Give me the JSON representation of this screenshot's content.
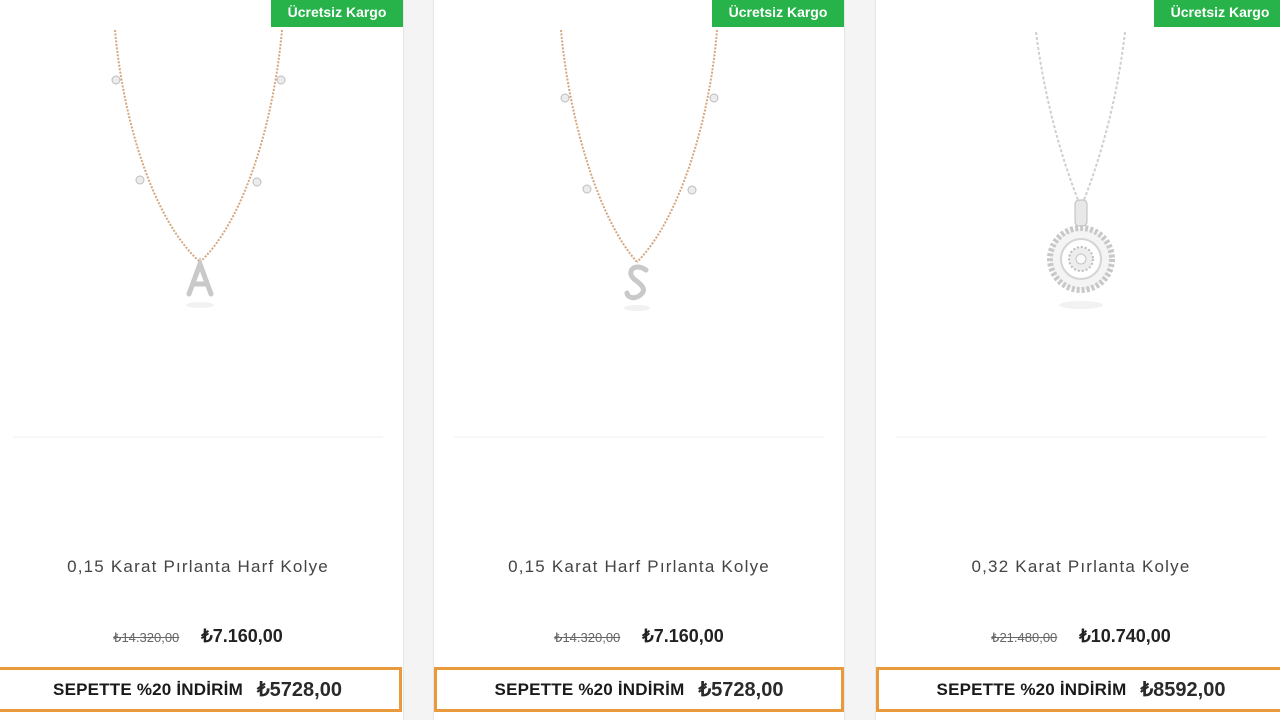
{
  "products": [
    {
      "badge": "Ücretsiz Kargo",
      "image": "letter-a-rose-gold-necklace",
      "name": "0,15 Karat Pırlanta Harf Kolye",
      "old_price": "₺14.320,00",
      "price": "₺7.160,00",
      "basket_label": "SEPETTE %20 İNDİRİM",
      "basket_price": "₺5728,00"
    },
    {
      "badge": "Ücretsiz Kargo",
      "image": "letter-s-rose-gold-necklace",
      "name": "0,15 Karat Harf Pırlanta Kolye",
      "old_price": "₺14.320,00",
      "price": "₺7.160,00",
      "basket_label": "SEPETTE %20 İNDİRİM",
      "basket_price": "₺5728,00"
    },
    {
      "badge": "Ücretsiz Kargo",
      "image": "round-halo-pendant-necklace",
      "name": "0,32 Karat Pırlanta Kolye",
      "old_price": "₺21.480,00",
      "price": "₺10.740,00",
      "basket_label": "SEPETTE %20 İNDİRİM",
      "basket_price": "₺8592,00"
    }
  ],
  "colors": {
    "badge_bg": "#27b24a",
    "discount_border": "#e99a3c",
    "rose_gold_chain": "#d6a77f",
    "silver": "#c9c9c9"
  }
}
